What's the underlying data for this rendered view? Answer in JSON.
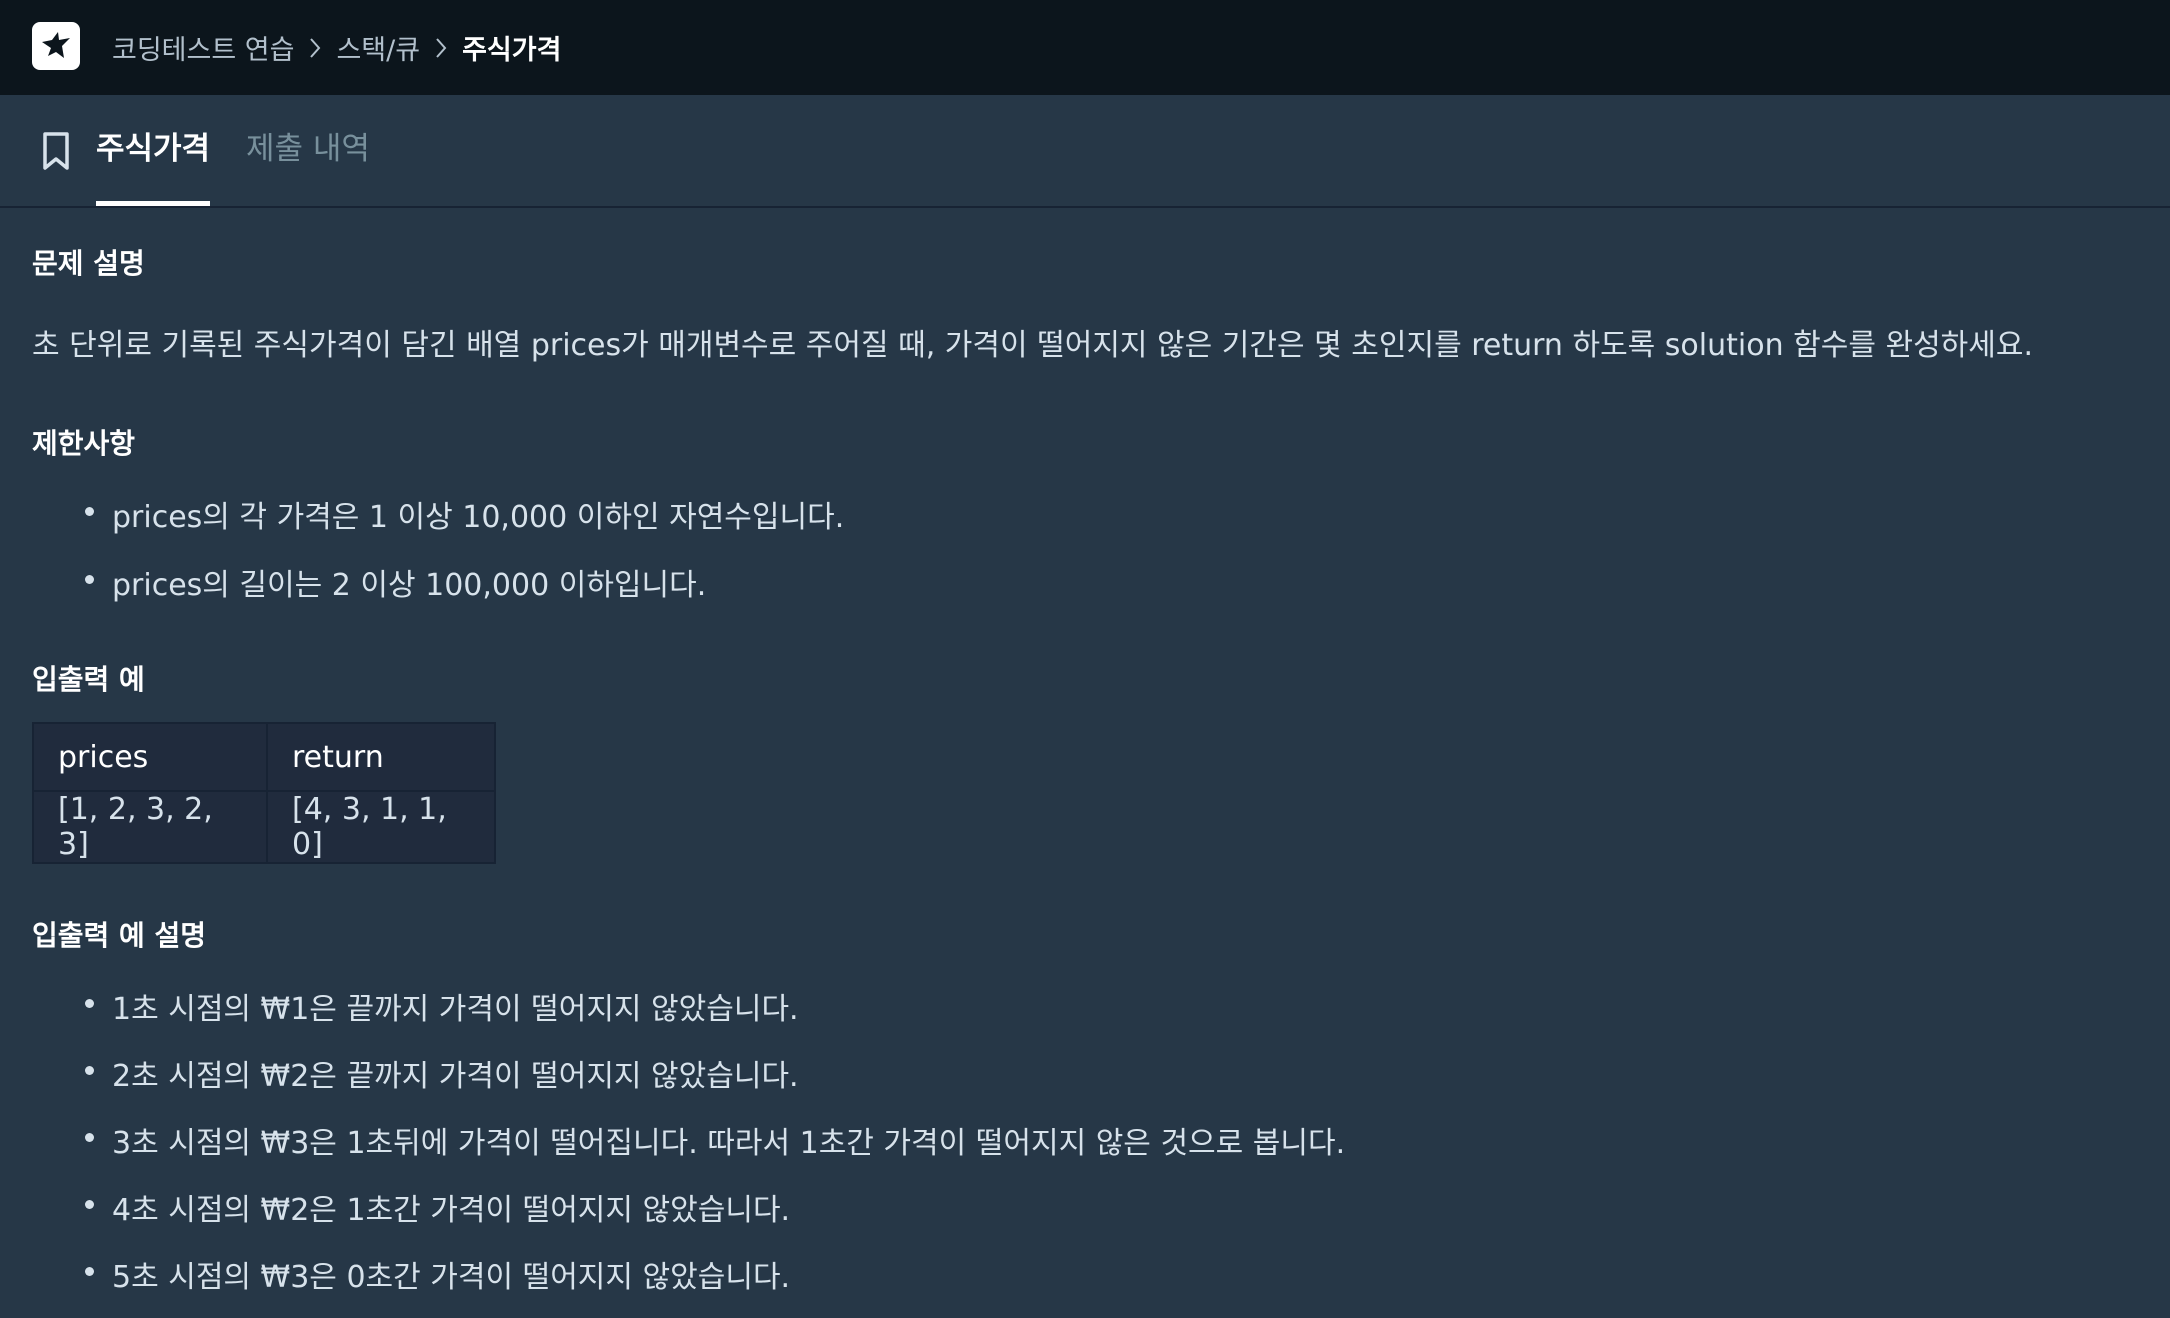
{
  "breadcrumb": {
    "items": [
      "코딩테스트 연습",
      "스택/큐"
    ],
    "current": "주식가격"
  },
  "tabs": {
    "active": "주식가격",
    "inactive": "제출 내역"
  },
  "problem": {
    "description_title": "문제 설명",
    "description": "초 단위로 기록된 주식가격이 담긴 배열 prices가 매개변수로 주어질 때, 가격이 떨어지지 않은 기간은 몇 초인지를 return 하도록 solution 함수를 완성하세요.",
    "constraints_title": "제한사항",
    "constraints": [
      "prices의 각 가격은 1 이상 10,000 이하인 자연수입니다.",
      "prices의 길이는 2 이상 100,000 이하입니다."
    ],
    "io_title": "입출력 예",
    "io_table": {
      "headers": [
        "prices",
        "return"
      ],
      "rows": [
        [
          "[1, 2, 3, 2, 3]",
          "[4, 3, 1, 1, 0]"
        ]
      ]
    },
    "io_explain_title": "입출력 예 설명",
    "io_explain": [
      "1초 시점의 ₩1은 끝까지 가격이 떨어지지 않았습니다.",
      "2초 시점의 ₩2은 끝까지 가격이 떨어지지 않았습니다.",
      "3초 시점의 ₩3은 1초뒤에 가격이 떨어집니다. 따라서 1초간 가격이 떨어지지 않은 것으로 봅니다.",
      "4초 시점의 ₩2은 1초간 가격이 떨어지지 않았습니다.",
      "5초 시점의 ₩3은 0초간 가격이 떨어지지 않았습니다."
    ]
  },
  "icons": {
    "logo": "programmers-logo-icon",
    "tab": "bookmark-icon",
    "separator": "chevron-right-icon"
  }
}
